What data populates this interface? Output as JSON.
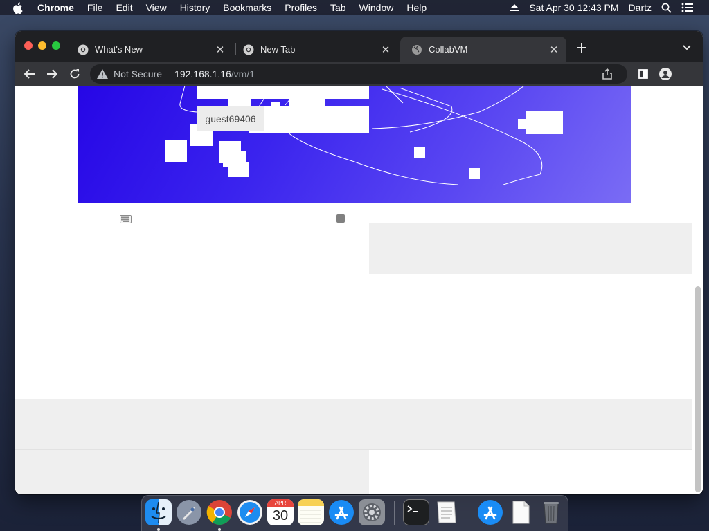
{
  "menubar": {
    "apple_icon": "apple-logo-icon",
    "app_name": "Chrome",
    "items": [
      "File",
      "Edit",
      "View",
      "History",
      "Bookmarks",
      "Profiles",
      "Tab",
      "Window",
      "Help"
    ],
    "clock": "Sat Apr 30  12:43 PM",
    "user": "Dartz"
  },
  "browser": {
    "tabs": [
      {
        "title": "What's New",
        "icon": "chrome-icon",
        "active": false
      },
      {
        "title": "New Tab",
        "icon": "chrome-icon",
        "active": false
      },
      {
        "title": "CollabVM",
        "icon": "globe-icon",
        "active": true
      }
    ],
    "address": {
      "security": "Not Secure",
      "host": "192.168.1.16",
      "path": "/vm/1"
    }
  },
  "page": {
    "vm_username_tooltip": "guest69406"
  },
  "dock": {
    "apps": [
      "finder-icon",
      "launchpad-icon",
      "chrome-icon",
      "safari-icon",
      "calendar-icon",
      "notes-icon",
      "app-store-icon",
      "system-preferences-icon",
      "terminal-icon",
      "textedit-icon",
      "app-store-icon",
      "document-icon",
      "trash-icon"
    ],
    "calendar": {
      "month": "APR",
      "day": "30"
    }
  },
  "colors": {
    "vm_gradient_start": "#2606e6",
    "vm_gradient_end": "#7a6cf4",
    "tab_active": "#35363a",
    "tabstrip": "#1f2023"
  }
}
